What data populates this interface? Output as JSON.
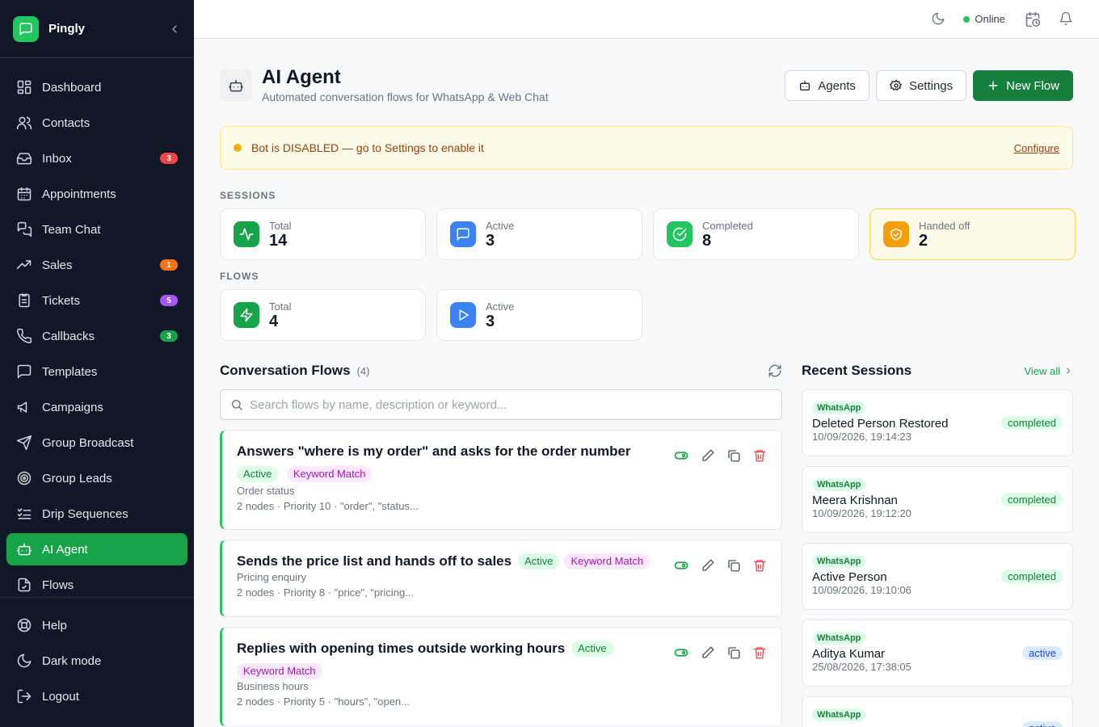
{
  "brand": {
    "name": "Pingly"
  },
  "sidebar": {
    "items": [
      {
        "label": "Dashboard",
        "icon": "dashboard-icon"
      },
      {
        "label": "Contacts",
        "icon": "contacts-icon"
      },
      {
        "label": "Inbox",
        "icon": "inbox-icon",
        "badge": "3",
        "badge_color": "#ef4444"
      },
      {
        "label": "Appointments",
        "icon": "calendar-icon"
      },
      {
        "label": "Team Chat",
        "icon": "team-chat-icon"
      },
      {
        "label": "Sales",
        "icon": "sales-icon",
        "badge": "1",
        "badge_color": "#f97316"
      },
      {
        "label": "Tickets",
        "icon": "ticket-icon",
        "badge": "5",
        "badge_color": "#a855f7"
      },
      {
        "label": "Callbacks",
        "icon": "phone-icon",
        "badge": "3",
        "badge_color": "#16a34a"
      },
      {
        "label": "Templates",
        "icon": "template-icon"
      },
      {
        "label": "Campaigns",
        "icon": "megaphone-icon"
      },
      {
        "label": "Group Broadcast",
        "icon": "send-icon"
      },
      {
        "label": "Group Leads",
        "icon": "target-icon"
      },
      {
        "label": "Drip Sequences",
        "icon": "list-check-icon"
      },
      {
        "label": "AI Agent",
        "icon": "bot-icon",
        "active": true
      },
      {
        "label": "Flows",
        "icon": "flows-icon"
      }
    ],
    "bottom": [
      {
        "label": "Help",
        "icon": "help-icon"
      },
      {
        "label": "Dark mode",
        "icon": "moon-icon"
      },
      {
        "label": "Logout",
        "icon": "logout-icon"
      }
    ]
  },
  "topbar": {
    "status": "Online"
  },
  "header": {
    "title": "AI Agent",
    "subtitle": "Automated conversation flows for WhatsApp & Web Chat",
    "agents_label": "Agents",
    "settings_label": "Settings",
    "new_flow_label": "New Flow"
  },
  "alert": {
    "text": "Bot is DISABLED — go to Settings to enable it",
    "link": "Configure"
  },
  "sessions": {
    "label": "SESSIONS",
    "stats": [
      {
        "label": "Total",
        "value": "14",
        "color": "#16a34a",
        "icon": "activity-icon"
      },
      {
        "label": "Active",
        "value": "3",
        "color": "#3b82f6",
        "icon": "message-icon"
      },
      {
        "label": "Completed",
        "value": "8",
        "color": "#22c55e",
        "icon": "check-circle-icon"
      },
      {
        "label": "Handed off",
        "value": "2",
        "color": "#f59e0b",
        "icon": "handoff-icon"
      }
    ]
  },
  "flows": {
    "label": "FLOWS",
    "stats": [
      {
        "label": "Total",
        "value": "4",
        "color": "#16a34a",
        "icon": "zap-icon"
      },
      {
        "label": "Active",
        "value": "3",
        "color": "#3b82f6",
        "icon": "play-icon"
      }
    ]
  },
  "conversation_flows": {
    "title": "Conversation Flows",
    "count": "(4)",
    "search_placeholder": "Search flows by name, description or keyword...",
    "items": [
      {
        "title": "Answers \"where is my order\" and asks for the order number",
        "status": "Active",
        "trigger": "Keyword Match",
        "description": "Order status",
        "meta": "2 nodes · Priority 10 · \"order\", \"status..."
      },
      {
        "title": "Sends the price list and hands off to sales",
        "status": "Active",
        "trigger": "Keyword Match",
        "description": "Pricing enquiry",
        "meta": "2 nodes · Priority 8 · \"price\", \"pricing..."
      },
      {
        "title": "Replies with opening times outside working hours",
        "status": "Active",
        "trigger": "Keyword Match",
        "description": "Business hours",
        "meta": "2 nodes · Priority 5 · \"hours\", \"open..."
      }
    ]
  },
  "recent_sessions": {
    "title": "Recent Sessions",
    "view_all": "View all",
    "items": [
      {
        "channel": "WhatsApp",
        "name": "Deleted Person Restored",
        "time": "10/09/2026, 19:14:23",
        "status": "completed"
      },
      {
        "channel": "WhatsApp",
        "name": "Meera Krishnan",
        "time": "10/09/2026, 19:12:20",
        "status": "completed"
      },
      {
        "channel": "WhatsApp",
        "name": "Active Person",
        "time": "10/09/2026, 19:10:06",
        "status": "completed"
      },
      {
        "channel": "WhatsApp",
        "name": "Aditya Kumar",
        "time": "25/08/2026, 17:38:05",
        "status": "active"
      },
      {
        "channel": "WhatsApp",
        "name": "",
        "time": "",
        "status": "active"
      }
    ]
  }
}
